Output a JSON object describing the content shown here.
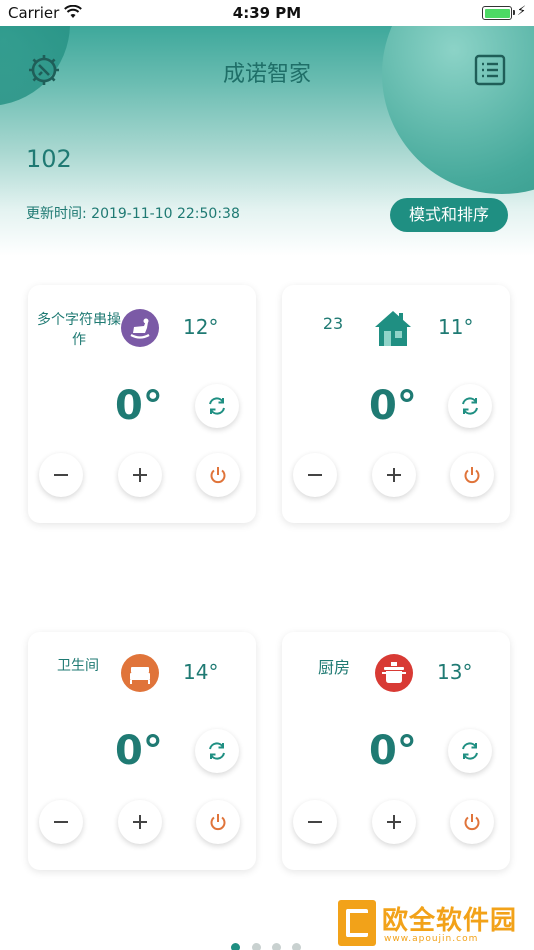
{
  "status_bar": {
    "carrier": "Carrier",
    "time": "4:39 PM"
  },
  "header": {
    "title": "成诺智家",
    "device_count": "102",
    "update_time": "更新时间: 2019-11-10 22:50:38",
    "mode_button_label": "模式和排序"
  },
  "rooms": [
    {
      "name": "多个字符串操作",
      "icon": "rocking-horse-icon",
      "icon_color": "#7b5aa6",
      "room_temp": "12°",
      "set_temp": "0°"
    },
    {
      "name": "23",
      "icon": "house-icon",
      "icon_color": "#1f8f82",
      "room_temp": "11°",
      "set_temp": "0°"
    },
    {
      "name": "卫生间",
      "icon": "bed-icon",
      "icon_color": "#e0743a",
      "room_temp": "14°",
      "set_temp": "0°"
    },
    {
      "name": "厨房",
      "icon": "cooking-pot-icon",
      "icon_color": "#d83a34",
      "room_temp": "13°",
      "set_temp": "0°"
    }
  ],
  "pagination": {
    "pages": 4,
    "current": 1
  },
  "colors": {
    "accent": "#1f8f82",
    "power": "#e0743a"
  },
  "watermark": {
    "title": "欧全软件园",
    "url": "www.apoujin.com"
  }
}
